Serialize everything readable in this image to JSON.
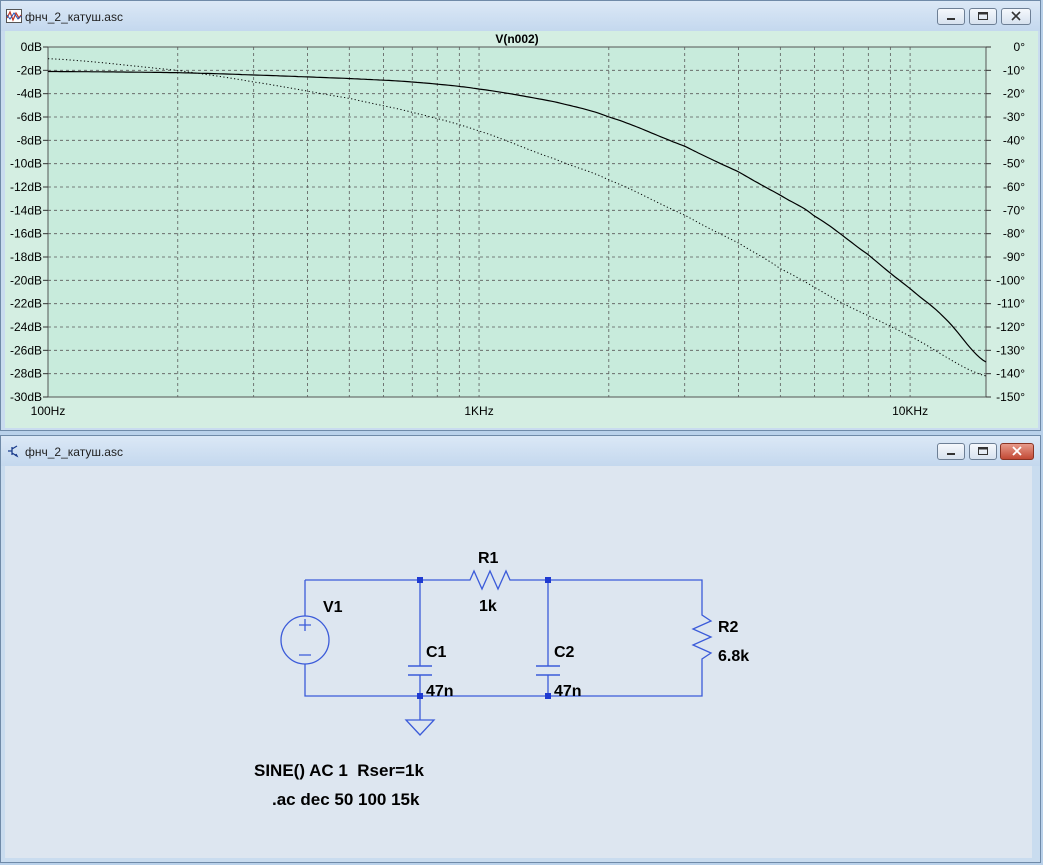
{
  "plot_window": {
    "title": "фнч_2_катуш.asc",
    "trace_label": "V(n002)",
    "left_axis_ticks": [
      "0dB",
      "-2dB",
      "-4dB",
      "-6dB",
      "-8dB",
      "-10dB",
      "-12dB",
      "-14dB",
      "-16dB",
      "-18dB",
      "-20dB",
      "-22dB",
      "-24dB",
      "-26dB",
      "-28dB",
      "-30dB"
    ],
    "right_axis_ticks": [
      "0°",
      "-10°",
      "-20°",
      "-30°",
      "-40°",
      "-50°",
      "-60°",
      "-70°",
      "-80°",
      "-90°",
      "-100°",
      "-110°",
      "-120°",
      "-130°",
      "-140°",
      "-150°"
    ],
    "x_axis_ticks": [
      "100Hz",
      "1KHz",
      "10KHz"
    ]
  },
  "chart_data": {
    "type": "line",
    "title": "V(n002)",
    "x_scale": "log",
    "xlim": [
      100,
      15000
    ],
    "ylim_left": [
      -30,
      0
    ],
    "ylim_right": [
      -150,
      0
    ],
    "grid": true,
    "series": [
      {
        "name": "magnitude (dB)",
        "style": "solid",
        "x": [
          100,
          200,
          300,
          500,
          700,
          1000,
          1500,
          2000,
          3000,
          4000,
          5000,
          6000,
          8000,
          10000,
          12000,
          15000
        ],
        "y": [
          -2.1,
          -2.2,
          -2.4,
          -2.7,
          -3.0,
          -3.6,
          -4.7,
          -6.0,
          -8.5,
          -10.7,
          -12.7,
          -14.5,
          -17.8,
          -20.7,
          -23.2,
          -27.0
        ]
      },
      {
        "name": "phase (deg)",
        "style": "dotted",
        "x": [
          100,
          200,
          300,
          500,
          700,
          1000,
          1500,
          2000,
          3000,
          4000,
          5000,
          7000,
          10000,
          15000
        ],
        "y": [
          -5,
          -10,
          -15,
          -22,
          -28,
          -36,
          -48,
          -57,
          -72,
          -84,
          -95,
          -110,
          -124,
          -141
        ]
      }
    ]
  },
  "schematic_window": {
    "title": "фнч_2_катуш.asc",
    "components": {
      "v1_name": "V1",
      "r1_name": "R1",
      "r1_value": "1k",
      "r2_name": "R2",
      "r2_value": "6.8k",
      "c1_name": "C1",
      "c1_value": "47n",
      "c2_name": "C2",
      "c2_value": "47n"
    },
    "directives": {
      "source": "SINE() AC 1  Rser=1k",
      "analysis": ".ac dec 50 100 15k"
    }
  },
  "colors": {
    "plot_bg": "#c8ebdc",
    "wire": "#3b5bd9",
    "grid": "#5a5a5a",
    "trace": "#000000",
    "schematic_bg": "#dde6f0"
  }
}
